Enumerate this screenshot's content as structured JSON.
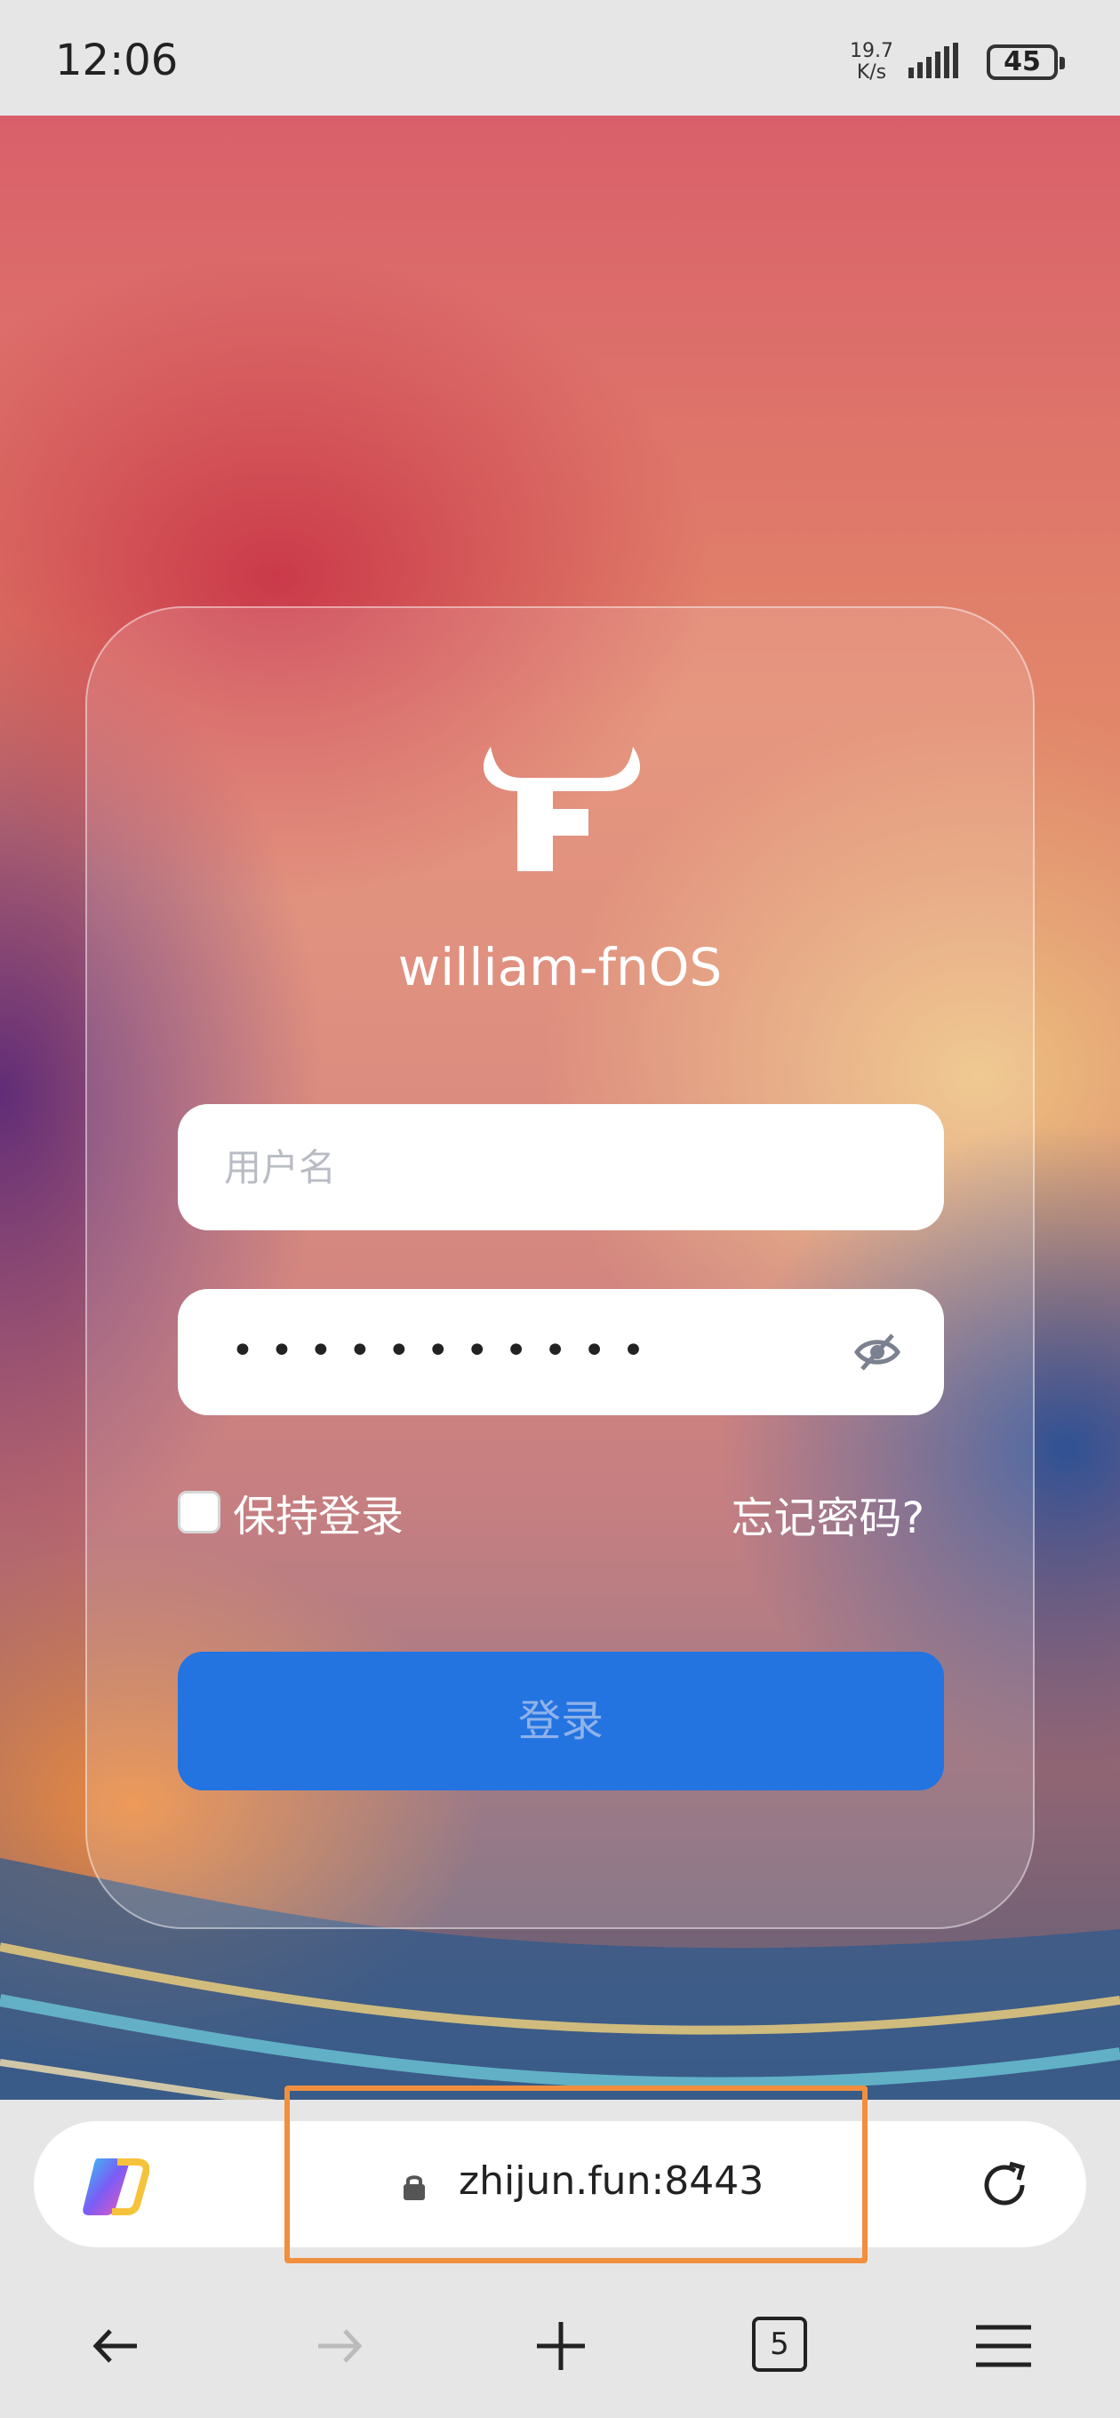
{
  "status_bar": {
    "time": "12:06",
    "net_speed_value": "19.7",
    "net_speed_unit": "K/s",
    "battery": "45"
  },
  "login": {
    "hostname": "william-fnOS",
    "username_placeholder": "用户名",
    "password_masked": "•••••••••••",
    "remember_label": "保持登录",
    "forgot_label": "忘记密码?",
    "login_button": "登录",
    "remember_checked": false
  },
  "browser": {
    "url": "zhijun.fun:8443",
    "tab_count": "5"
  },
  "colors": {
    "accent": "#2373e1",
    "highlight": "#f08f3f"
  },
  "icons": [
    "copilot-icon",
    "lock-icon",
    "reload-icon",
    "back-icon",
    "forward-icon",
    "plus-icon",
    "tabs-icon",
    "menu-icon",
    "eye-off-icon",
    "fnos-logo"
  ]
}
